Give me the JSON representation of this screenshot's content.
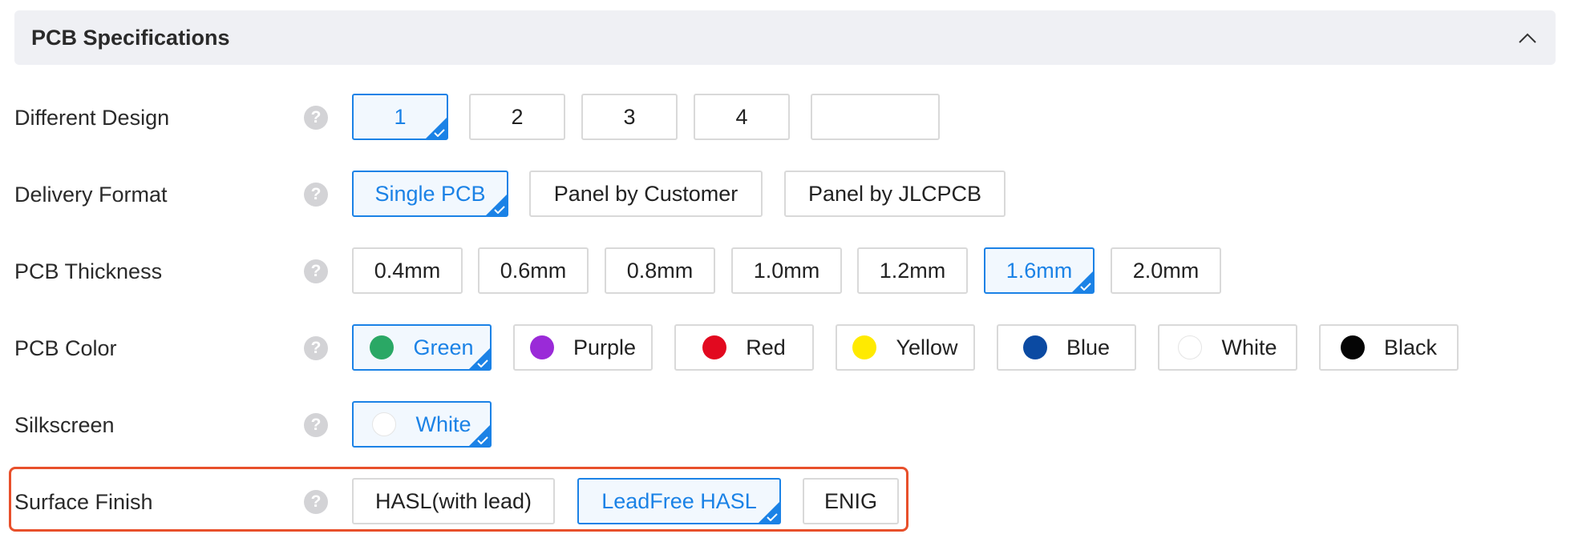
{
  "header": {
    "title": "PCB Specifications",
    "collapse_icon": "chevron-up-icon"
  },
  "help_glyph": "?",
  "check_glyph": "checkmark-icon",
  "rows": {
    "design": {
      "label": "Different Design",
      "options": [
        "1",
        "2",
        "3",
        "4",
        ""
      ],
      "selected": "1"
    },
    "delivery": {
      "label": "Delivery Format",
      "options": [
        "Single PCB",
        "Panel by Customer",
        "Panel by JLCPCB"
      ],
      "selected": "Single PCB"
    },
    "thickness": {
      "label": "PCB Thickness",
      "options": [
        "0.4mm",
        "0.6mm",
        "0.8mm",
        "1.0mm",
        "1.2mm",
        "1.6mm",
        "2.0mm"
      ],
      "selected": "1.6mm"
    },
    "color": {
      "label": "PCB Color",
      "options": [
        "Green",
        "Purple",
        "Red",
        "Yellow",
        "Blue",
        "White",
        "Black"
      ],
      "swatches": [
        "#2aa865",
        "#9a2ad8",
        "#e2091f",
        "#ffea00",
        "#0b4aa2",
        "#ffffff",
        "#050505"
      ],
      "selected": "Green"
    },
    "silkscreen": {
      "label": "Silkscreen",
      "options": [
        "White"
      ],
      "swatches": [
        "#ffffff"
      ],
      "selected": "White"
    },
    "surface": {
      "label": "Surface Finish",
      "options": [
        "HASL(with lead)",
        "LeadFree HASL",
        "ENIG"
      ],
      "selected": "LeadFree HASL"
    }
  },
  "colors": {
    "accent": "#1b82e6",
    "highlight": "#e8502b",
    "header_bg": "#eff0f4"
  }
}
